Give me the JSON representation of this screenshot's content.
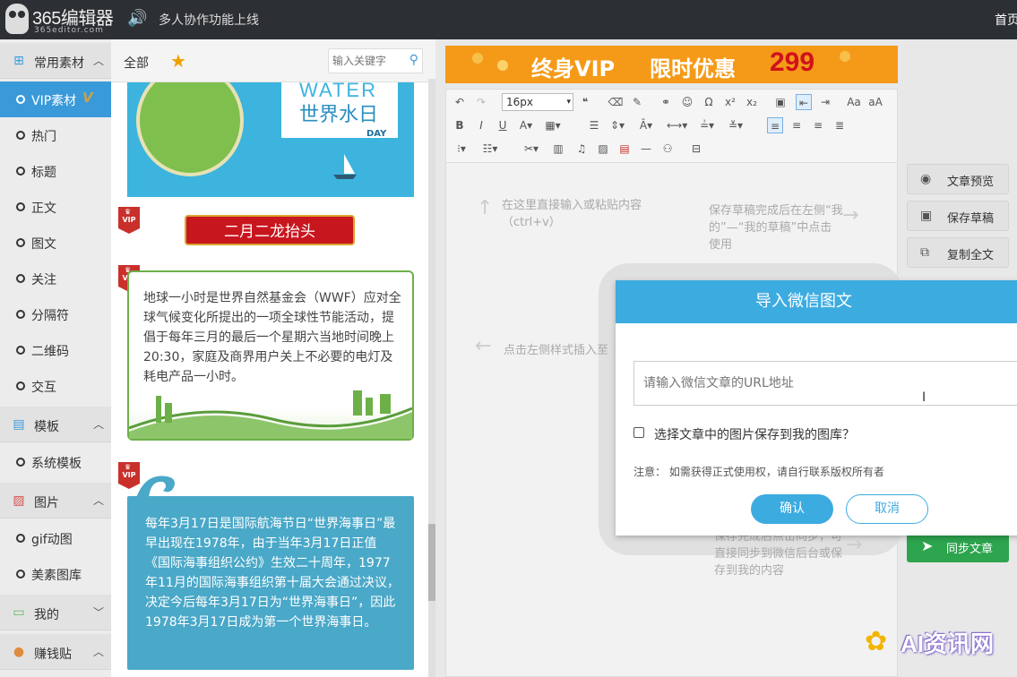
{
  "header": {
    "logo_name": "365编辑器",
    "logo_sub": "365editor.com",
    "announcement": "多人协作功能上线",
    "home_link": "首页"
  },
  "sidebar": {
    "common_label": "常用素材",
    "items": [
      "VIP素材",
      "热门",
      "标题",
      "正文",
      "图文",
      "关注",
      "分隔符",
      "二维码",
      "交互"
    ],
    "template_label": "模板",
    "template_items": [
      "系统模板"
    ],
    "image_label": "图片",
    "image_items": [
      "gif动图",
      "美素图库"
    ],
    "mine_label": "我的",
    "earn_label": "赚钱贴"
  },
  "panel": {
    "tab_all": "全部",
    "search_placeholder": "输入关键字",
    "water_en": "WATER",
    "water_cn": "世界水日",
    "water_day": "DAY",
    "vip_badge": "VIP",
    "banner_text": "二月二龙抬头",
    "card1_text": "地球一小时是世界自然基金会（WWF）应对全球气候变化所提出的一项全球性节能活动，提倡于每年三月的最后一个星期六当地时间晚上20:30，家庭及商界用户关上不必要的电灯及耗电产品一小时。",
    "card2_text": "每年3月17日是国际航海节日“世界海事日”最早出现在1978年，由于当年3月17日正值《国际海事组织公约》生效二十周年，1977年11月的国际海事组织第十届大会通过决议，决定今后每年3月17日为“世界海事日”，因此1978年3月17日成为第一个世界海事日。"
  },
  "ad": {
    "text1": "终身VIP",
    "text2": "限时优惠",
    "price": "299"
  },
  "editor": {
    "font_size": "16px",
    "hint_paste": "在这里直接输入或粘贴内容（ctrl+v）",
    "hint_save": "保存草稿完成后在左侧“我的”—“我的草稿”中点击使用",
    "hint_insert": "点击左侧样式插入至",
    "hint_sync": "保存完成后点击同步，可直接同步到微信后台或保存到我的内容"
  },
  "right_buttons": {
    "preview": "文章预览",
    "save_draft": "保存草稿",
    "copy_all": "复制全文",
    "sync": "同步文章"
  },
  "modal": {
    "title": "导入微信图文",
    "url_placeholder": "请输入微信文章的URL地址",
    "checkbox_label": "选择文章中的图片保存到我的图库？",
    "note": "注意：  如需获得正式使用权，请自行联系版权所有者",
    "confirm": "确认",
    "cancel": "取消"
  },
  "watermark": {
    "text": "AI资讯网"
  },
  "colors": {
    "accent": "#3cabe0",
    "sidebar_active": "#3a9ad9",
    "sync_green": "#2da44e",
    "ad_orange": "#f59a18"
  }
}
